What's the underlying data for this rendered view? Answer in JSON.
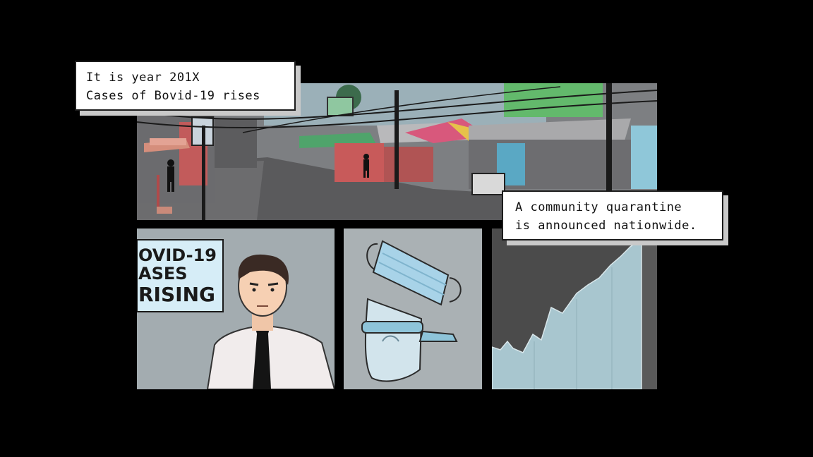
{
  "captions": {
    "intro": {
      "line1": "It is year 201X",
      "line2": "Cases of Bovid-19 rises"
    },
    "quarantine": {
      "line1": "A community quarantine",
      "line2": "is announced nationwide."
    }
  },
  "sign": {
    "line1": "OVID-19",
    "line2": "ASES",
    "line3": "RISING"
  },
  "colors": {
    "background": "#000000",
    "caption_bg": "#ffffff",
    "mask_blue": "#a8d3e8",
    "chart_fill": "#a8c6cf"
  }
}
